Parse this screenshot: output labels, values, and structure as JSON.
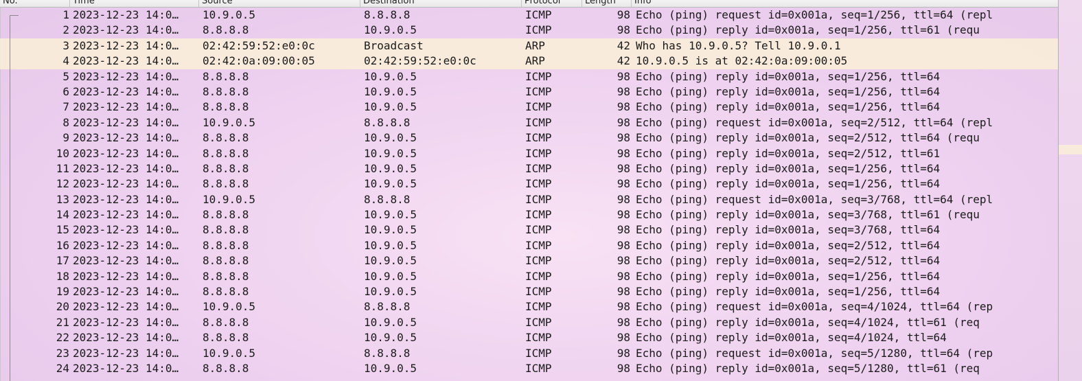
{
  "columns": {
    "no": "No.",
    "time": "Time",
    "source": "Source",
    "destination": "Destination",
    "protocol": "Protocol",
    "length": "Length",
    "info": "Info"
  },
  "packets": [
    {
      "no": "1",
      "time": "2023-12-23 14:0…",
      "source": "10.9.0.5",
      "destination": "8.8.8.8",
      "protocol": "ICMP",
      "length": "98",
      "info": "Echo (ping) request  id=0x001a, seq=1/256, ttl=64 (repl"
    },
    {
      "no": "2",
      "time": "2023-12-23 14:0…",
      "source": "8.8.8.8",
      "destination": "10.9.0.5",
      "protocol": "ICMP",
      "length": "98",
      "info": "Echo (ping) reply    id=0x001a, seq=1/256, ttl=61 (requ"
    },
    {
      "no": "3",
      "time": "2023-12-23 14:0…",
      "source": "02:42:59:52:e0:0c",
      "destination": "Broadcast",
      "protocol": "ARP",
      "length": "42",
      "info": "Who has 10.9.0.5? Tell 10.9.0.1"
    },
    {
      "no": "4",
      "time": "2023-12-23 14:0…",
      "source": "02:42:0a:09:00:05",
      "destination": "02:42:59:52:e0:0c",
      "protocol": "ARP",
      "length": "42",
      "info": "10.9.0.5 is at 02:42:0a:09:00:05"
    },
    {
      "no": "5",
      "time": "2023-12-23 14:0…",
      "source": "8.8.8.8",
      "destination": "10.9.0.5",
      "protocol": "ICMP",
      "length": "98",
      "info": "Echo (ping) reply    id=0x001a, seq=1/256, ttl=64"
    },
    {
      "no": "6",
      "time": "2023-12-23 14:0…",
      "source": "8.8.8.8",
      "destination": "10.9.0.5",
      "protocol": "ICMP",
      "length": "98",
      "info": "Echo (ping) reply    id=0x001a, seq=1/256, ttl=64"
    },
    {
      "no": "7",
      "time": "2023-12-23 14:0…",
      "source": "8.8.8.8",
      "destination": "10.9.0.5",
      "protocol": "ICMP",
      "length": "98",
      "info": "Echo (ping) reply    id=0x001a, seq=1/256, ttl=64"
    },
    {
      "no": "8",
      "time": "2023-12-23 14:0…",
      "source": "10.9.0.5",
      "destination": "8.8.8.8",
      "protocol": "ICMP",
      "length": "98",
      "info": "Echo (ping) request  id=0x001a, seq=2/512, ttl=64 (repl"
    },
    {
      "no": "9",
      "time": "2023-12-23 14:0…",
      "source": "8.8.8.8",
      "destination": "10.9.0.5",
      "protocol": "ICMP",
      "length": "98",
      "info": "Echo (ping) reply    id=0x001a, seq=2/512, ttl=64 (requ"
    },
    {
      "no": "10",
      "time": "2023-12-23 14:0…",
      "source": "8.8.8.8",
      "destination": "10.9.0.5",
      "protocol": "ICMP",
      "length": "98",
      "info": "Echo (ping) reply    id=0x001a, seq=2/512, ttl=61"
    },
    {
      "no": "11",
      "time": "2023-12-23 14:0…",
      "source": "8.8.8.8",
      "destination": "10.9.0.5",
      "protocol": "ICMP",
      "length": "98",
      "info": "Echo (ping) reply    id=0x001a, seq=1/256, ttl=64"
    },
    {
      "no": "12",
      "time": "2023-12-23 14:0…",
      "source": "8.8.8.8",
      "destination": "10.9.0.5",
      "protocol": "ICMP",
      "length": "98",
      "info": "Echo (ping) reply    id=0x001a, seq=1/256, ttl=64"
    },
    {
      "no": "13",
      "time": "2023-12-23 14:0…",
      "source": "10.9.0.5",
      "destination": "8.8.8.8",
      "protocol": "ICMP",
      "length": "98",
      "info": "Echo (ping) request  id=0x001a, seq=3/768, ttl=64 (repl"
    },
    {
      "no": "14",
      "time": "2023-12-23 14:0…",
      "source": "8.8.8.8",
      "destination": "10.9.0.5",
      "protocol": "ICMP",
      "length": "98",
      "info": "Echo (ping) reply    id=0x001a, seq=3/768, ttl=61 (requ"
    },
    {
      "no": "15",
      "time": "2023-12-23 14:0…",
      "source": "8.8.8.8",
      "destination": "10.9.0.5",
      "protocol": "ICMP",
      "length": "98",
      "info": "Echo (ping) reply    id=0x001a, seq=3/768, ttl=64"
    },
    {
      "no": "16",
      "time": "2023-12-23 14:0…",
      "source": "8.8.8.8",
      "destination": "10.9.0.5",
      "protocol": "ICMP",
      "length": "98",
      "info": "Echo (ping) reply    id=0x001a, seq=2/512, ttl=64"
    },
    {
      "no": "17",
      "time": "2023-12-23 14:0…",
      "source": "8.8.8.8",
      "destination": "10.9.0.5",
      "protocol": "ICMP",
      "length": "98",
      "info": "Echo (ping) reply    id=0x001a, seq=2/512, ttl=64"
    },
    {
      "no": "18",
      "time": "2023-12-23 14:0…",
      "source": "8.8.8.8",
      "destination": "10.9.0.5",
      "protocol": "ICMP",
      "length": "98",
      "info": "Echo (ping) reply    id=0x001a, seq=1/256, ttl=64"
    },
    {
      "no": "19",
      "time": "2023-12-23 14:0…",
      "source": "8.8.8.8",
      "destination": "10.9.0.5",
      "protocol": "ICMP",
      "length": "98",
      "info": "Echo (ping) reply    id=0x001a, seq=1/256, ttl=64"
    },
    {
      "no": "20",
      "time": "2023-12-23 14:0…",
      "source": "10.9.0.5",
      "destination": "8.8.8.8",
      "protocol": "ICMP",
      "length": "98",
      "info": "Echo (ping) request  id=0x001a, seq=4/1024, ttl=64 (rep"
    },
    {
      "no": "21",
      "time": "2023-12-23 14:0…",
      "source": "8.8.8.8",
      "destination": "10.9.0.5",
      "protocol": "ICMP",
      "length": "98",
      "info": "Echo (ping) reply    id=0x001a, seq=4/1024, ttl=61 (req"
    },
    {
      "no": "22",
      "time": "2023-12-23 14:0…",
      "source": "8.8.8.8",
      "destination": "10.9.0.5",
      "protocol": "ICMP",
      "length": "98",
      "info": "Echo (ping) reply    id=0x001a, seq=4/1024, ttl=64"
    },
    {
      "no": "23",
      "time": "2023-12-23 14:0…",
      "source": "10.9.0.5",
      "destination": "8.8.8.8",
      "protocol": "ICMP",
      "length": "98",
      "info": "Echo (ping) request  id=0x001a, seq=5/1280, ttl=64 (rep"
    },
    {
      "no": "24",
      "time": "2023-12-23 14:0…",
      "source": "8.8.8.8",
      "destination": "10.9.0.5",
      "protocol": "ICMP",
      "length": "98",
      "info": "Echo (ping) reply    id=0x001a, seq=5/1280, ttl=61 (req"
    }
  ],
  "colors": {
    "arp_row": "#faf0d7",
    "background": "#efd6ef"
  }
}
